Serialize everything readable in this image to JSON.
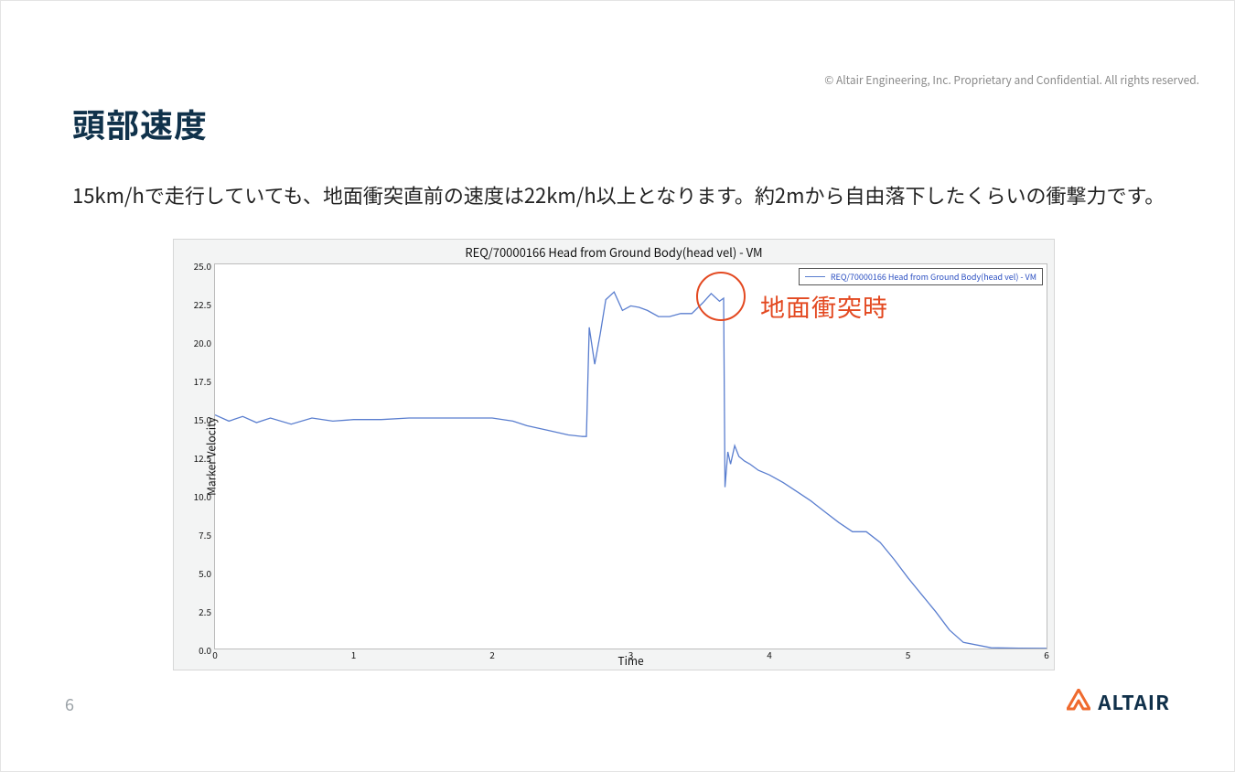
{
  "copyright": "© Altair Engineering, Inc. Proprietary and Confidential. All rights reserved.",
  "title": "頭部速度",
  "description": "15km/hで走行していても、地面衝突直前の速度は22km/h以上となります。約2mから自由落下したくらいの衝撃力です。",
  "page_number": "6",
  "brand": "ALTAIR",
  "annotation": {
    "label": "地面衝突時"
  },
  "legend": {
    "label": "REQ/70000166 Head from Ground Body(head vel) - VM"
  },
  "chart_data": {
    "type": "line",
    "title": "REQ/70000166 Head from Ground Body(head vel) - VM",
    "xlabel": "Time",
    "ylabel": "Marker Velocity",
    "xlim": [
      0,
      6
    ],
    "ylim": [
      0,
      25
    ],
    "xticks": [
      0,
      1,
      2,
      3,
      4,
      5,
      6
    ],
    "yticks": [
      0.0,
      2.5,
      5.0,
      7.5,
      10.0,
      12.5,
      15.0,
      17.5,
      20.0,
      22.5,
      25.0
    ],
    "series": [
      {
        "name": "REQ/70000166 Head from Ground Body(head vel) - VM",
        "color": "#5a7ecf",
        "x": [
          0.0,
          0.1,
          0.2,
          0.3,
          0.4,
          0.55,
          0.7,
          0.85,
          1.0,
          1.2,
          1.4,
          1.6,
          1.8,
          2.0,
          2.15,
          2.25,
          2.4,
          2.55,
          2.65,
          2.68,
          2.7,
          2.74,
          2.78,
          2.82,
          2.88,
          2.94,
          3.0,
          3.06,
          3.12,
          3.2,
          3.28,
          3.36,
          3.44,
          3.52,
          3.58,
          3.64,
          3.67,
          3.68,
          3.7,
          3.72,
          3.75,
          3.78,
          3.82,
          3.86,
          3.92,
          4.0,
          4.1,
          4.2,
          4.3,
          4.4,
          4.5,
          4.6,
          4.7,
          4.8,
          4.9,
          5.0,
          5.1,
          5.2,
          5.3,
          5.4,
          5.6,
          5.8,
          6.0
        ],
        "y": [
          15.2,
          14.8,
          15.1,
          14.7,
          15.0,
          14.6,
          15.0,
          14.8,
          14.9,
          14.9,
          15.0,
          15.0,
          15.0,
          15.0,
          14.8,
          14.5,
          14.2,
          13.9,
          13.8,
          13.8,
          20.9,
          18.5,
          20.5,
          22.7,
          23.2,
          22.0,
          22.3,
          22.2,
          22.0,
          21.6,
          21.6,
          21.8,
          21.8,
          22.5,
          23.1,
          22.6,
          22.8,
          10.5,
          12.8,
          12.0,
          13.2,
          12.5,
          12.2,
          12.0,
          11.6,
          11.3,
          10.8,
          10.2,
          9.6,
          8.9,
          8.2,
          7.6,
          7.6,
          6.9,
          5.8,
          4.6,
          3.5,
          2.4,
          1.2,
          0.4,
          0.05,
          0.02,
          0.01
        ]
      }
    ]
  }
}
